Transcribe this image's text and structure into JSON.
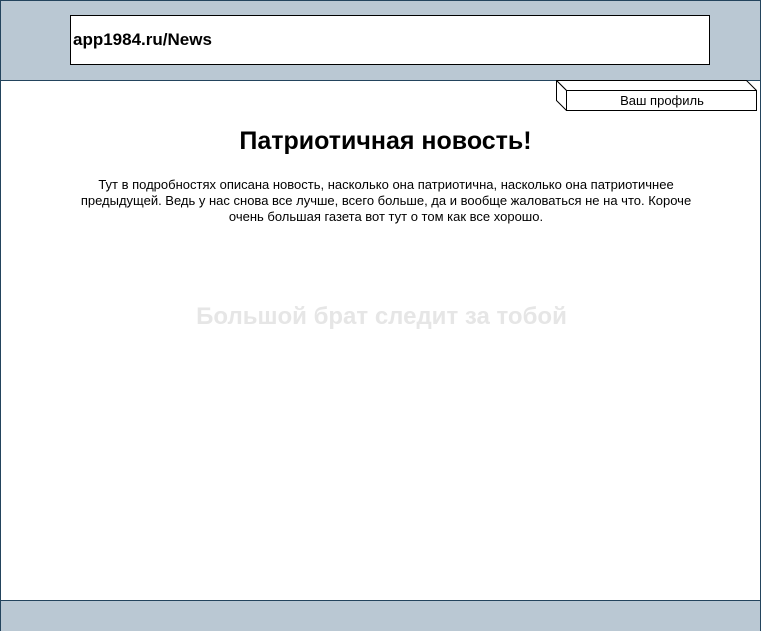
{
  "browser": {
    "address": "app1984.ru/News"
  },
  "header": {
    "profile_button_label": "Ваш профиль"
  },
  "article": {
    "title": "Патриотичная новость!",
    "body": "Тут в подробностях описана новость, насколько она патриотична, насколько она патриотичнее предыдущей. Ведь у нас снова все лучше, всего больше, да и вообще жаловаться не на что. Короче очень большая газета вот тут о том как все хорошо."
  },
  "watermark": {
    "text": "Большой брат следит за тобой"
  },
  "colors": {
    "bar_fill": "#bac8d3",
    "bar_border": "#23445d",
    "watermark": "#e6e6e6"
  }
}
